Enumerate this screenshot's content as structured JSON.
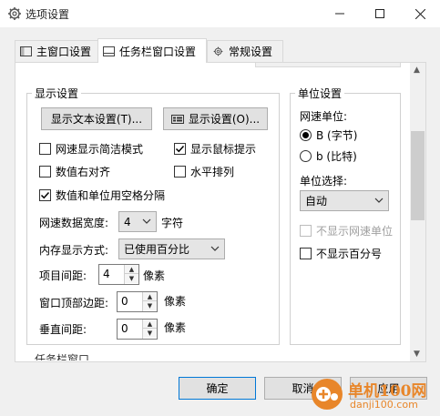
{
  "window": {
    "title": "选项设置",
    "icon": "gear-icon"
  },
  "tabs": [
    {
      "label": "主窗口设置",
      "icon": "window-icon",
      "active": false
    },
    {
      "label": "任务栏窗口设置",
      "icon": "taskbar-icon",
      "active": true
    },
    {
      "label": "常规设置",
      "icon": "gear-icon",
      "active": false
    }
  ],
  "display": {
    "group_label": "显示设置",
    "text_settings_button": "显示文本设置(T)...",
    "display_settings_button": "显示设置(O)...",
    "checkboxes": [
      {
        "label": "网速显示简洁模式",
        "checked": false
      },
      {
        "label": "显示鼠标提示",
        "checked": true
      },
      {
        "label": "数值右对齐",
        "checked": false
      },
      {
        "label": "水平排列",
        "checked": false
      },
      {
        "label": "数值和单位用空格分隔",
        "checked": true
      }
    ],
    "width_label": "网速数据宽度:",
    "width_value": "4",
    "width_unit": "字符",
    "memory_label": "内存显示方式:",
    "memory_value": "已使用百分比",
    "item_spacing_label": "项目间距:",
    "item_spacing_value": "4",
    "item_spacing_unit": "像素",
    "top_margin_label": "窗口顶部边距:",
    "top_margin_value": "0",
    "top_margin_unit": "像素",
    "vertical_spacing_label": "垂直间距:",
    "vertical_spacing_value": "0",
    "vertical_spacing_unit": "像素"
  },
  "units": {
    "group_label": "单位设置",
    "speed_unit_label": "网速单位:",
    "radios": [
      {
        "label": "B (字节)",
        "selected": true
      },
      {
        "label": "b (比特)",
        "selected": false
      }
    ],
    "unit_select_label": "单位选择:",
    "unit_select_value": "自动",
    "hide_speed_unit": {
      "label": "不显示网速单位",
      "checked": false,
      "disabled": true
    },
    "hide_percent": {
      "label": "不显示百分号",
      "checked": false,
      "disabled": false
    }
  },
  "next_section_label": "任务栏窗口",
  "footer": {
    "ok": "确定",
    "cancel": "取消",
    "apply": "应用"
  },
  "watermark": {
    "text": "单机100网",
    "url": "danji100.com"
  },
  "colors": {
    "accent": "#0078d7",
    "watermark": "#e8862a"
  }
}
